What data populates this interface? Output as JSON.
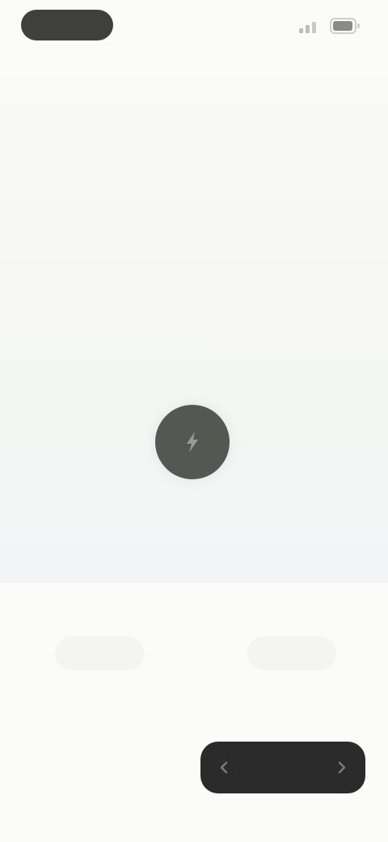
{
  "status_bar": {
    "time": "",
    "icons": [
      "signal-icon",
      "battery-icon"
    ]
  },
  "preview": {
    "caption": ""
  },
  "recorder": {
    "icon": "bolt-icon",
    "label": ""
  },
  "options": {
    "left_label": "",
    "right_label": ""
  },
  "actions": {
    "secondary_label": "",
    "primary_label": "",
    "primary_icon_left": "chevron-left-icon",
    "primary_icon_right": "chevron-right-icon"
  },
  "colors": {
    "primary_button": "#2b2b2b",
    "record_button": "#555753",
    "background": "#fbfbfa"
  }
}
